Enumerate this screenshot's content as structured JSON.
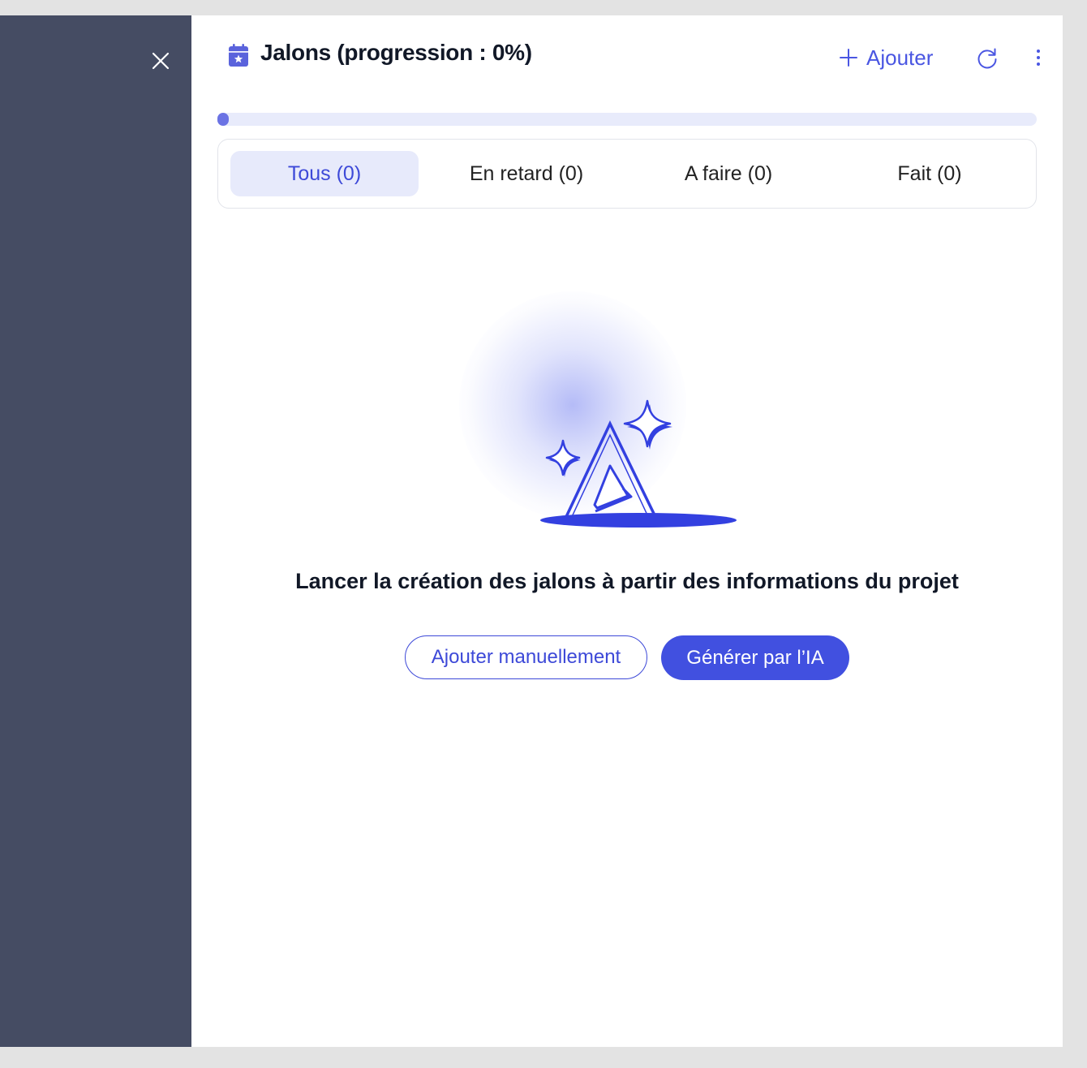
{
  "header": {
    "title": "Jalons (progression : 0%)",
    "add_label": "Ajouter",
    "progress_fraction": 0
  },
  "tabs": [
    {
      "label": "Tous (0)",
      "active": true
    },
    {
      "label": "En retard (0)",
      "active": false
    },
    {
      "label": "A faire (0)",
      "active": false
    },
    {
      "label": "Fait (0)",
      "active": false
    }
  ],
  "empty_state": {
    "message": "Lancer la création des jalons à partir des informations du projet",
    "manual_button": "Ajouter manuellement",
    "ai_button": "Générer par l’IA"
  },
  "icons": {
    "close": "close-icon",
    "calendar": "calendar-star-icon",
    "add": "plus-icon",
    "refresh": "refresh-icon",
    "more": "more-vertical-icon"
  },
  "colors": {
    "accent": "#4150e0",
    "overlay": "#454c63",
    "tab_active_bg": "#e7eafb",
    "progress_track": "#e8ebfb",
    "progress_fill": "#6b73e4"
  }
}
